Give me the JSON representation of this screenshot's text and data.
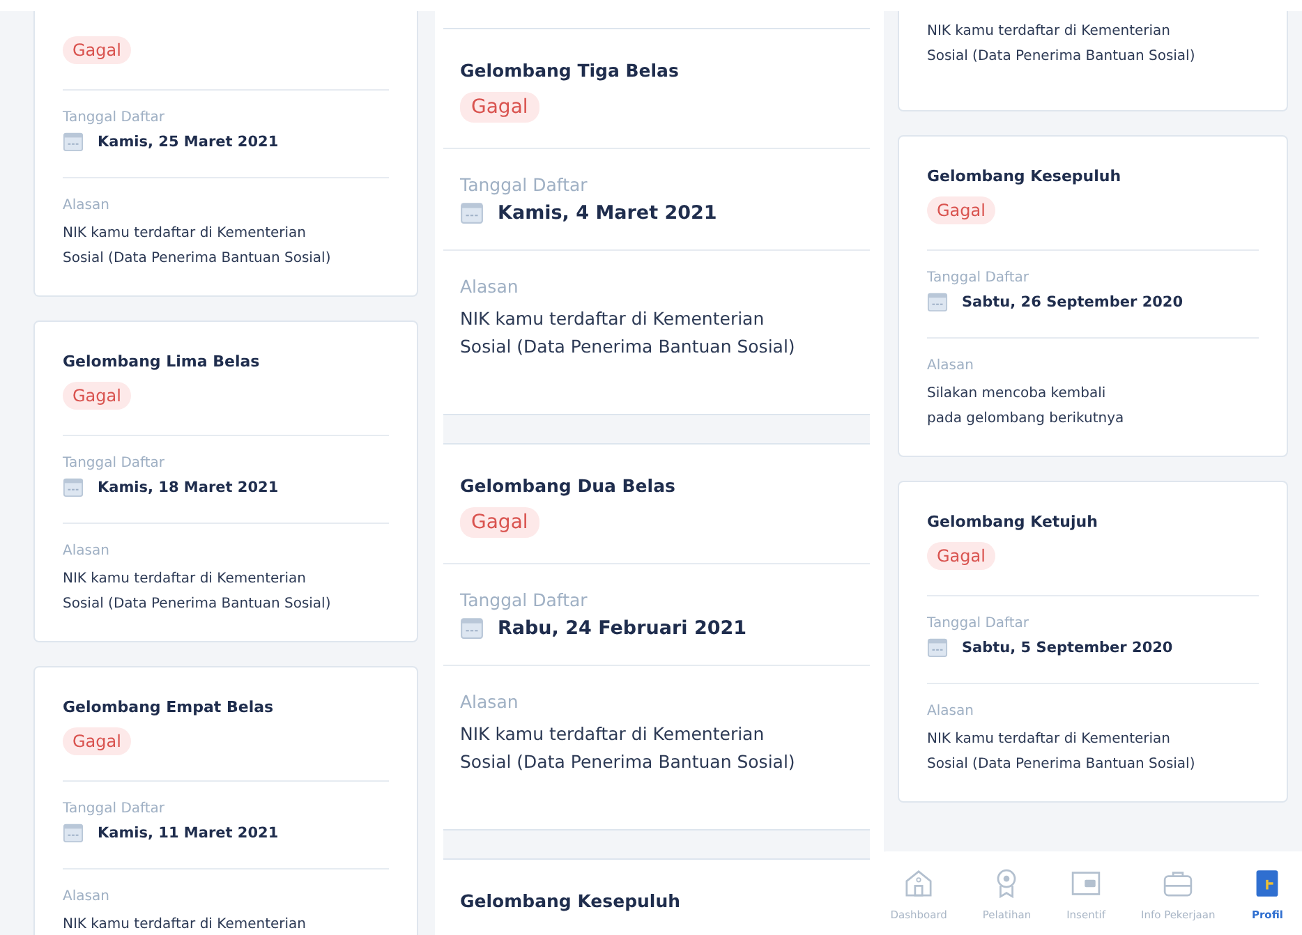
{
  "panels": [
    {
      "kind": "cards",
      "cards": [
        {
          "status": "Gagal",
          "date_label": "Tanggal Daftar",
          "date": "Kamis, 25 Maret 2021",
          "reason_label": "Alasan",
          "reason": "NIK kamu terdaftar di Kementerian\nSosial (Data Penerima Bantuan Sosial)"
        },
        {
          "title": "Gelombang Lima Belas",
          "status": "Gagal",
          "date_label": "Tanggal Daftar",
          "date": "Kamis, 18 Maret 2021",
          "reason_label": "Alasan",
          "reason": "NIK kamu terdaftar di Kementerian\nSosial (Data Penerima Bantuan Sosial)"
        },
        {
          "title": "Gelombang Empat Belas",
          "status": "Gagal",
          "date_label": "Tanggal Daftar",
          "date": "Kamis, 11 Maret 2021",
          "reason_label": "Alasan",
          "reason": "NIK kamu terdaftar di Kementerian"
        }
      ]
    },
    {
      "kind": "list",
      "cards": [
        {
          "title": "Gelombang Tiga Belas",
          "status": "Gagal",
          "date_label": "Tanggal Daftar",
          "date": "Kamis, 4 Maret 2021",
          "reason_label": "Alasan",
          "reason": "NIK kamu terdaftar di Kementerian\nSosial (Data Penerima Bantuan Sosial)"
        },
        {
          "title": "Gelombang Dua Belas",
          "status": "Gagal",
          "date_label": "Tanggal Daftar",
          "date": "Rabu, 24 Februari 2021",
          "reason_label": "Alasan",
          "reason": "NIK kamu terdaftar di Kementerian\nSosial (Data Penerima Bantuan Sosial)"
        },
        {
          "title": "Gelombang Kesepuluh"
        }
      ]
    },
    {
      "kind": "cards",
      "cards": [
        {
          "reason": "NIK kamu terdaftar di Kementerian\nSosial (Data Penerima Bantuan Sosial)"
        },
        {
          "title": "Gelombang Kesepuluh",
          "status": "Gagal",
          "date_label": "Tanggal Daftar",
          "date": "Sabtu, 26 September 2020",
          "reason_label": "Alasan",
          "reason": "Silakan mencoba kembali\npada gelombang berikutnya"
        },
        {
          "title": "Gelombang Ketujuh",
          "status": "Gagal",
          "date_label": "Tanggal Daftar",
          "date": "Sabtu, 5 September 2020",
          "reason_label": "Alasan",
          "reason": "NIK kamu terdaftar di Kementerian\nSosial (Data Penerima Bantuan Sosial)"
        }
      ],
      "nav": [
        {
          "label": "Dashboard",
          "selected": false
        },
        {
          "label": "Pelatihan",
          "selected": false
        },
        {
          "label": "Insentif",
          "selected": false
        },
        {
          "label": "Info Pekerjaan",
          "selected": false
        },
        {
          "label": "Profil",
          "selected": true
        }
      ]
    }
  ]
}
